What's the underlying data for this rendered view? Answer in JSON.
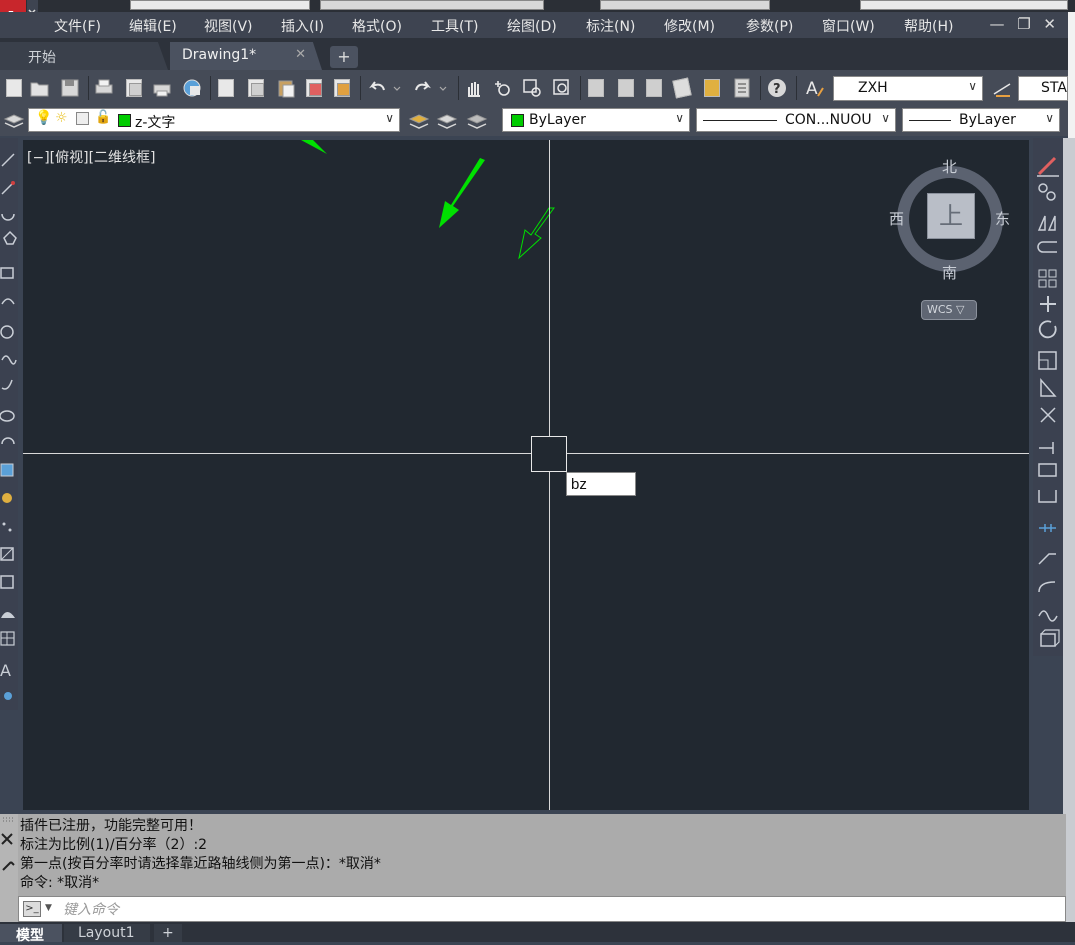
{
  "menu": {
    "items": [
      "文件(F)",
      "编辑(E)",
      "视图(V)",
      "插入(I)",
      "格式(O)",
      "工具(T)",
      "绘图(D)",
      "标注(N)",
      "修改(M)",
      "参数(P)",
      "窗口(W)",
      "帮助(H)"
    ],
    "window_controls": "— ❐ ✕"
  },
  "tabs": {
    "start": "开始",
    "drawing": "Drawing1*",
    "close": "✕",
    "add": "+"
  },
  "toolbar": {
    "text_style": "ZXH",
    "dim_style": "STA"
  },
  "layers": {
    "current_layer": "z-文字",
    "layer_color": "#00cc00",
    "color": "ByLayer",
    "linetype": "CON...NUOU",
    "lineweight": "ByLayer"
  },
  "viewport": {
    "label": "[−][俯视][二维线框]",
    "dynamic_input": "bz"
  },
  "viewcube": {
    "north": "北",
    "south": "南",
    "east": "东",
    "west": "西",
    "face": "上",
    "wcs": "WCS ▽"
  },
  "command": {
    "history": [
      "插件已注册，功能完整可用！",
      "标注为比例(1)/百分率（2）:2",
      "第一点(按百分率时请选择靠近路轴线侧为第一点)：*取消*",
      "命令: *取消*"
    ],
    "placeholder": "键入命令"
  },
  "layout_tabs": {
    "model": "模型",
    "layout1": "Layout1",
    "add": "+"
  },
  "colors": {
    "canvas": "#212830",
    "accent_green": "#00e000"
  }
}
